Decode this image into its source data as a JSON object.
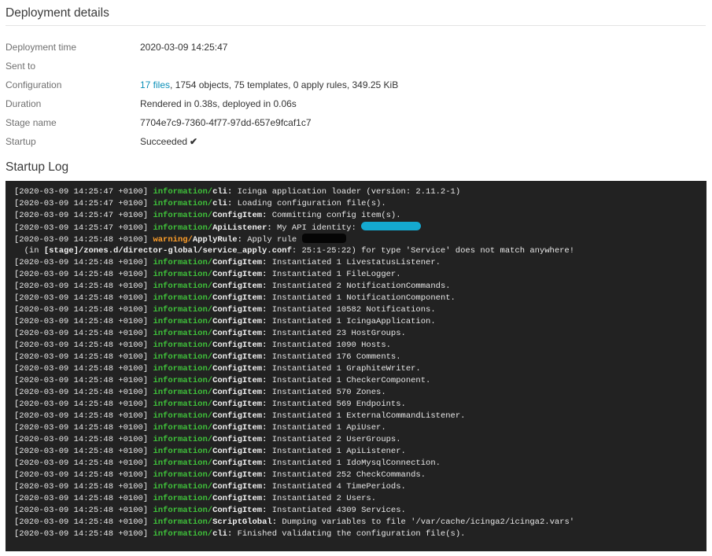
{
  "details": {
    "title": "Deployment details",
    "rows": [
      {
        "label": "Deployment time",
        "value": "2020-03-09 14:25:47"
      },
      {
        "label": "Sent to",
        "value": ""
      },
      {
        "label": "Configuration",
        "link": "17 files",
        "value": ", 1754 objects, 75 templates, 0 apply rules, 349.25 KiB"
      },
      {
        "label": "Duration",
        "value": "Rendered in 0.38s, deployed in 0.06s"
      },
      {
        "label": "Stage name",
        "value": "7704e7c9-7360-4f77-97dd-657e9fcaf1c7"
      },
      {
        "label": "Startup",
        "value": "Succeeded",
        "icon": "check-icon"
      }
    ]
  },
  "log": {
    "title": "Startup Log",
    "lines": [
      {
        "ts": "[2020-03-09 14:25:47 +0100]",
        "sev": "information",
        "fac": "cli",
        "msg": "Icinga application loader (version: 2.11.2-1)"
      },
      {
        "ts": "[2020-03-09 14:25:47 +0100]",
        "sev": "information",
        "fac": "cli",
        "msg": "Loading configuration file(s)."
      },
      {
        "ts": "[2020-03-09 14:25:47 +0100]",
        "sev": "information",
        "fac": "ConfigItem",
        "msg": "Committing config item(s)."
      },
      {
        "ts": "[2020-03-09 14:25:47 +0100]",
        "sev": "information",
        "fac": "ApiListener",
        "msg": "My API identity: ",
        "redact": "blue"
      },
      {
        "ts": "[2020-03-09 14:25:48 +0100]",
        "sev": "warning",
        "fac": "ApplyRule",
        "msg": "Apply rule ",
        "redact": "black"
      },
      {
        "cont_pre": "  (in ",
        "cont_path": "[stage]/zones.d/director-global/service_apply.conf",
        "cont_post": ": 25:1-25:22) for type 'Service' does not match anywhere!"
      },
      {
        "ts": "[2020-03-09 14:25:48 +0100]",
        "sev": "information",
        "fac": "ConfigItem",
        "msg": "Instantiated 1 LivestatusListener."
      },
      {
        "ts": "[2020-03-09 14:25:48 +0100]",
        "sev": "information",
        "fac": "ConfigItem",
        "msg": "Instantiated 1 FileLogger."
      },
      {
        "ts": "[2020-03-09 14:25:48 +0100]",
        "sev": "information",
        "fac": "ConfigItem",
        "msg": "Instantiated 2 NotificationCommands."
      },
      {
        "ts": "[2020-03-09 14:25:48 +0100]",
        "sev": "information",
        "fac": "ConfigItem",
        "msg": "Instantiated 1 NotificationComponent."
      },
      {
        "ts": "[2020-03-09 14:25:48 +0100]",
        "sev": "information",
        "fac": "ConfigItem",
        "msg": "Instantiated 10582 Notifications."
      },
      {
        "ts": "[2020-03-09 14:25:48 +0100]",
        "sev": "information",
        "fac": "ConfigItem",
        "msg": "Instantiated 1 IcingaApplication."
      },
      {
        "ts": "[2020-03-09 14:25:48 +0100]",
        "sev": "information",
        "fac": "ConfigItem",
        "msg": "Instantiated 23 HostGroups."
      },
      {
        "ts": "[2020-03-09 14:25:48 +0100]",
        "sev": "information",
        "fac": "ConfigItem",
        "msg": "Instantiated 1090 Hosts."
      },
      {
        "ts": "[2020-03-09 14:25:48 +0100]",
        "sev": "information",
        "fac": "ConfigItem",
        "msg": "Instantiated 176 Comments."
      },
      {
        "ts": "[2020-03-09 14:25:48 +0100]",
        "sev": "information",
        "fac": "ConfigItem",
        "msg": "Instantiated 1 GraphiteWriter."
      },
      {
        "ts": "[2020-03-09 14:25:48 +0100]",
        "sev": "information",
        "fac": "ConfigItem",
        "msg": "Instantiated 1 CheckerComponent."
      },
      {
        "ts": "[2020-03-09 14:25:48 +0100]",
        "sev": "information",
        "fac": "ConfigItem",
        "msg": "Instantiated 570 Zones."
      },
      {
        "ts": "[2020-03-09 14:25:48 +0100]",
        "sev": "information",
        "fac": "ConfigItem",
        "msg": "Instantiated 569 Endpoints."
      },
      {
        "ts": "[2020-03-09 14:25:48 +0100]",
        "sev": "information",
        "fac": "ConfigItem",
        "msg": "Instantiated 1 ExternalCommandListener."
      },
      {
        "ts": "[2020-03-09 14:25:48 +0100]",
        "sev": "information",
        "fac": "ConfigItem",
        "msg": "Instantiated 1 ApiUser."
      },
      {
        "ts": "[2020-03-09 14:25:48 +0100]",
        "sev": "information",
        "fac": "ConfigItem",
        "msg": "Instantiated 2 UserGroups."
      },
      {
        "ts": "[2020-03-09 14:25:48 +0100]",
        "sev": "information",
        "fac": "ConfigItem",
        "msg": "Instantiated 1 ApiListener."
      },
      {
        "ts": "[2020-03-09 14:25:48 +0100]",
        "sev": "information",
        "fac": "ConfigItem",
        "msg": "Instantiated 1 IdoMysqlConnection."
      },
      {
        "ts": "[2020-03-09 14:25:48 +0100]",
        "sev": "information",
        "fac": "ConfigItem",
        "msg": "Instantiated 252 CheckCommands."
      },
      {
        "ts": "[2020-03-09 14:25:48 +0100]",
        "sev": "information",
        "fac": "ConfigItem",
        "msg": "Instantiated 4 TimePeriods."
      },
      {
        "ts": "[2020-03-09 14:25:48 +0100]",
        "sev": "information",
        "fac": "ConfigItem",
        "msg": "Instantiated 2 Users."
      },
      {
        "ts": "[2020-03-09 14:25:48 +0100]",
        "sev": "information",
        "fac": "ConfigItem",
        "msg": "Instantiated 4309 Services."
      },
      {
        "ts": "[2020-03-09 14:25:48 +0100]",
        "sev": "information",
        "fac": "ScriptGlobal",
        "msg": "Dumping variables to file '/var/cache/icinga2/icinga2.vars'"
      },
      {
        "ts": "[2020-03-09 14:25:48 +0100]",
        "sev": "information",
        "fac": "cli",
        "msg": "Finished validating the configuration file(s)."
      }
    ]
  }
}
